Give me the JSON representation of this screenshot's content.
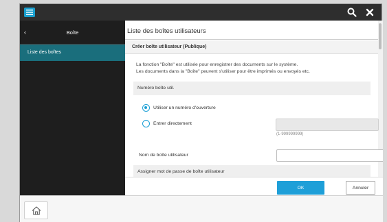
{
  "topbar": {
    "menu_icon": "menu-icon",
    "search_icon": "search-icon",
    "close_icon": "close-icon"
  },
  "sidebar": {
    "back_icon": "‹",
    "title": "Boîte",
    "items": [
      {
        "label": "Liste des boîtes"
      }
    ]
  },
  "main": {
    "title": "Liste des boîtes utilisateurs",
    "panel_title": "Créer boîte utilisateur (Publique)",
    "description_line1": "La fonction \"Boîte\" est utilisée pour enregistrer des documents sur le système.",
    "description_line2": "Les documents dans la \"Boîte\" peuvent s'utiliser pour être imprimés ou envoyés etc.",
    "box_number_section": "Numéro boîte util.",
    "radio_opening_number": "Utiliser un numéro d'ouverture",
    "radio_direct_entry": "Entrer directement",
    "number_input_value": "",
    "number_range_hint": "(1-999999999)",
    "box_name_label": "Nom de boîte utilisateur",
    "box_name_value": "",
    "password_section": "Assigner mot de passe de boîte utilisateur",
    "ok_label": "OK",
    "cancel_label": "Annuler"
  },
  "bottom": {
    "home_icon": "home-icon"
  },
  "colors": {
    "accent": "#1e9fd8",
    "sidebar_bg": "#1e1e1e",
    "sidebar_selected": "#1a6e7c",
    "topbar_bg": "#2e2e2e"
  }
}
